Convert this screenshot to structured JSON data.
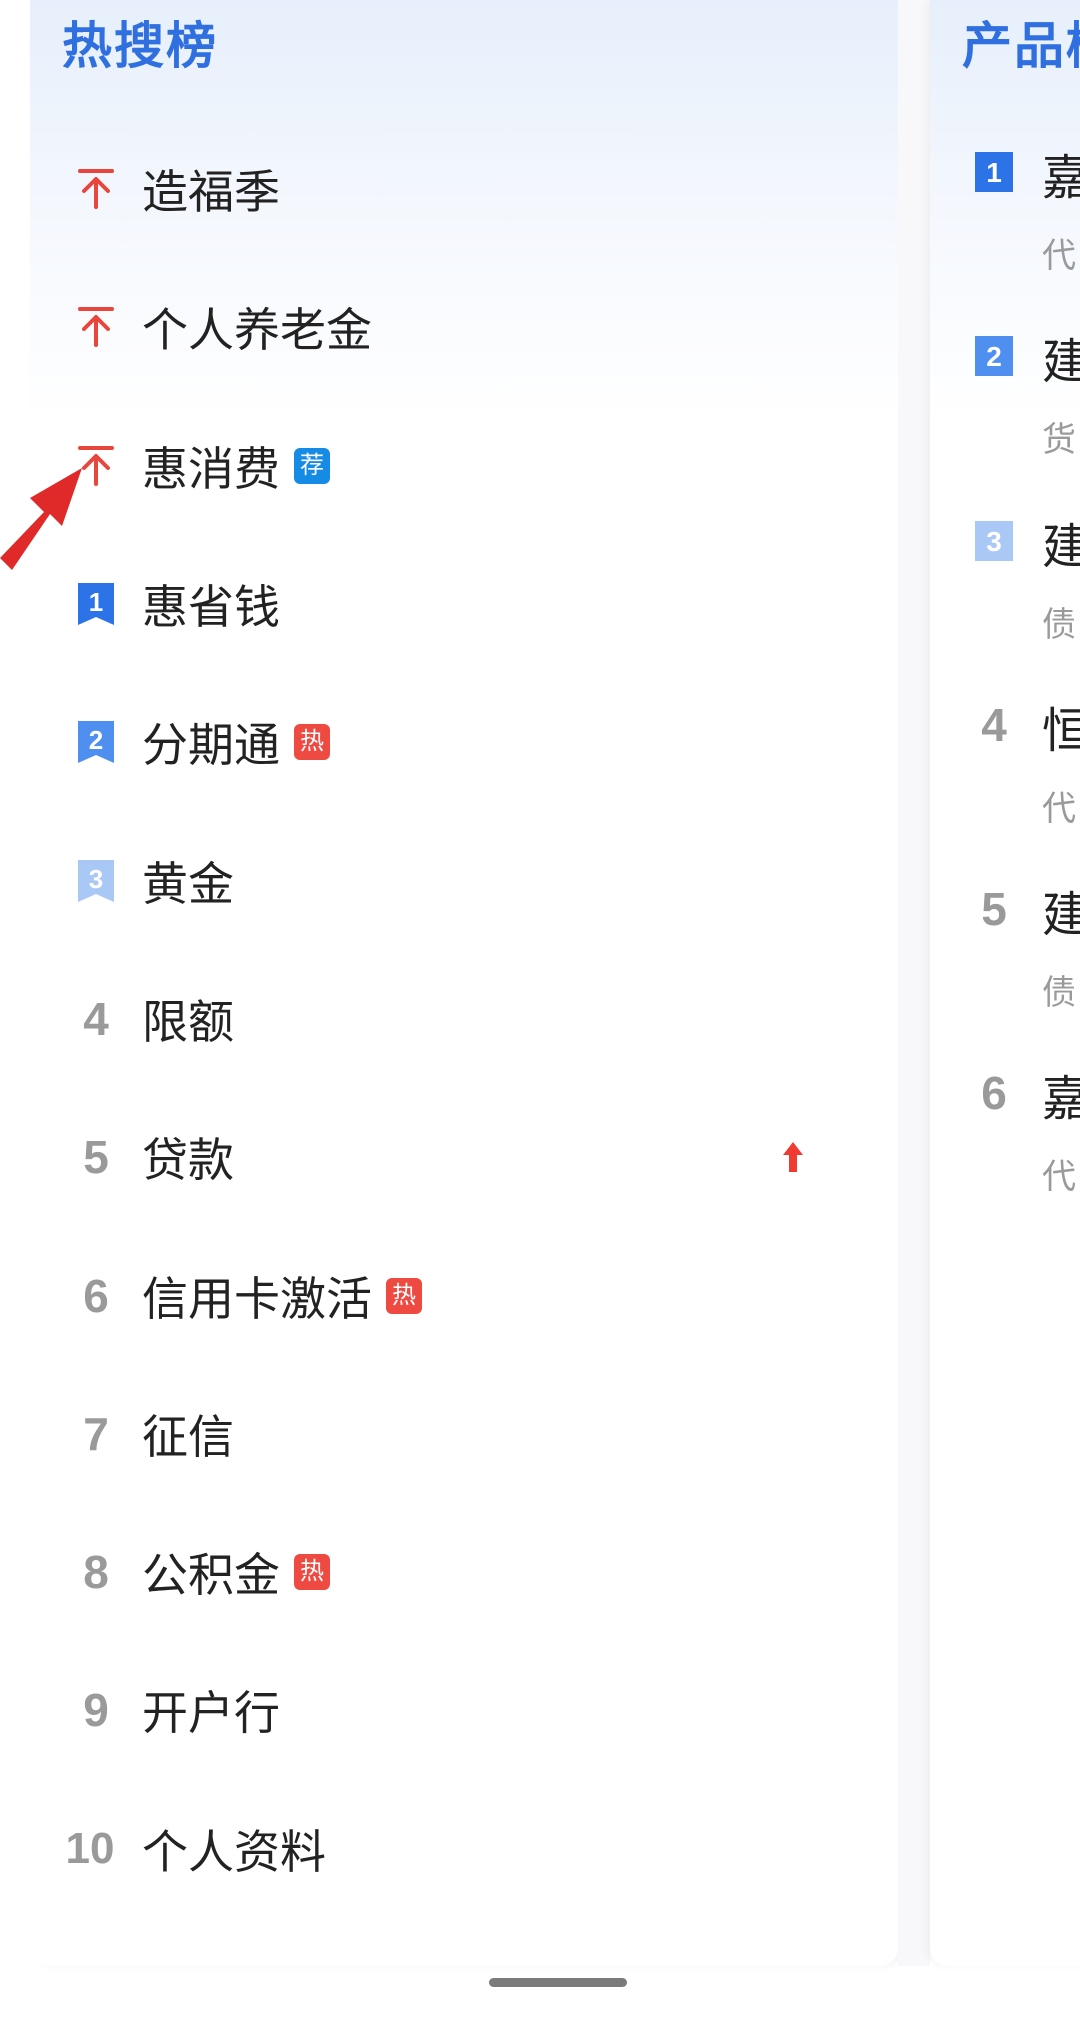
{
  "hot_board": {
    "title": "热搜榜",
    "items": [
      {
        "rank": "",
        "badge": "pin-top",
        "label": "造福季",
        "tag": ""
      },
      {
        "rank": "",
        "badge": "pin-top",
        "label": "个人养老金",
        "tag": ""
      },
      {
        "rank": "",
        "badge": "pin-top",
        "label": "惠消费",
        "tag": "荐"
      },
      {
        "rank": "1",
        "badge": "rank-ribbon",
        "label": "惠省钱",
        "tag": ""
      },
      {
        "rank": "2",
        "badge": "rank-ribbon",
        "label": "分期通",
        "tag": "热"
      },
      {
        "rank": "3",
        "badge": "rank-ribbon",
        "label": "黄金",
        "tag": ""
      },
      {
        "rank": "4",
        "badge": "plain",
        "label": "限额",
        "tag": ""
      },
      {
        "rank": "5",
        "badge": "plain",
        "label": "贷款",
        "tag": "",
        "trend": "up"
      },
      {
        "rank": "6",
        "badge": "plain",
        "label": "信用卡激活",
        "tag": "热"
      },
      {
        "rank": "7",
        "badge": "plain",
        "label": "征信",
        "tag": ""
      },
      {
        "rank": "8",
        "badge": "plain",
        "label": "公积金",
        "tag": "热"
      },
      {
        "rank": "9",
        "badge": "plain",
        "label": "开户行",
        "tag": ""
      },
      {
        "rank": "10",
        "badge": "plain",
        "label": "个人资料",
        "tag": ""
      }
    ]
  },
  "product_board": {
    "title": "产品榜",
    "items": [
      {
        "rank": "1",
        "title": "嘉",
        "subtitle": "代"
      },
      {
        "rank": "2",
        "title": "建",
        "subtitle": "货"
      },
      {
        "rank": "3",
        "title": "建",
        "subtitle": "债"
      },
      {
        "rank": "4",
        "title": "恒",
        "subtitle": "代"
      },
      {
        "rank": "5",
        "title": "建",
        "subtitle": "债"
      },
      {
        "rank": "6",
        "title": "嘉",
        "subtitle": "代"
      }
    ]
  },
  "colors": {
    "accent_blue": "#2f6fe0",
    "pin_red": "#e8453c",
    "hot_tag": "#ef4a42",
    "rec_tag": "#168be6",
    "rank1": "#2b73e6",
    "rank2": "#4f8ff0",
    "rank3": "#a9c8f6",
    "rank_plain": "#9a9a9a",
    "annotation_arrow": "#e02a2a"
  }
}
